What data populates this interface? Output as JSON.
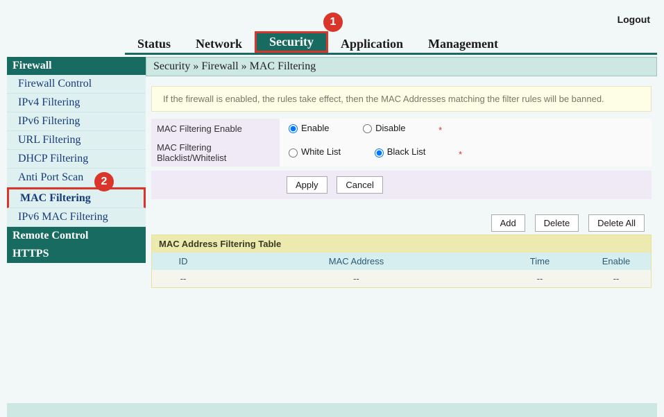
{
  "logout": "Logout",
  "topnav": {
    "status": "Status",
    "network": "Network",
    "security": "Security",
    "application": "Application",
    "management": "Management"
  },
  "annotations": {
    "n1": "1",
    "n2": "2"
  },
  "sidebar": {
    "section_firewall": "Firewall",
    "items": [
      "Firewall Control",
      "IPv4 Filtering",
      "IPv6 Filtering",
      "URL Filtering",
      "DHCP Filtering",
      "Anti Port Scan",
      "MAC Filtering",
      "IPv6 MAC Filtering"
    ],
    "section_remote": "Remote Control",
    "section_https": "HTTPS"
  },
  "breadcrumb": "Security » Firewall » MAC Filtering",
  "info_text": "If the firewall is enabled, the rules take effect, then the MAC Addresses matching the filter rules will be banned.",
  "form": {
    "row1_label": "MAC Filtering Enable",
    "enable": "Enable",
    "disable": "Disable",
    "row2_label": "MAC Filtering Blacklist/Whitelist",
    "whitelist": "White List",
    "blacklist": "Black List",
    "asterisk": "*",
    "apply": "Apply",
    "cancel": "Cancel"
  },
  "table_actions": {
    "add": "Add",
    "delete": "Delete",
    "delete_all": "Delete All"
  },
  "filter_table": {
    "title": "MAC Address Filtering Table",
    "col_id": "ID",
    "col_mac": "MAC Address",
    "col_time": "Time",
    "col_enable": "Enable",
    "row": {
      "id": "--",
      "mac": "--",
      "time": "--",
      "enable": "--"
    }
  }
}
